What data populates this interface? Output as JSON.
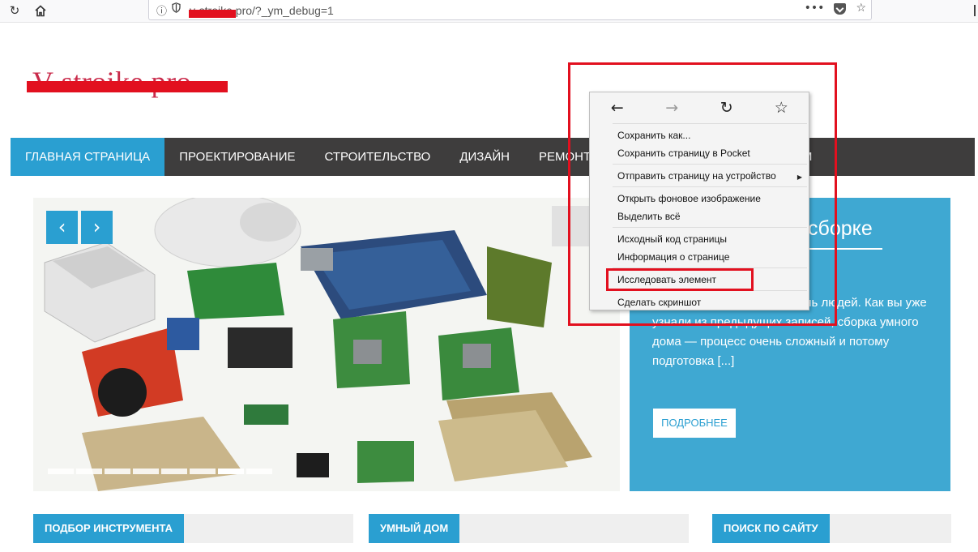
{
  "browser": {
    "url_text": "v-stroike.pro/?_ym_debug=1",
    "icons": {
      "reload": "reload-icon",
      "home": "home-icon",
      "info": "info-icon",
      "shield": "shield-icon",
      "more": "more-icon",
      "pocket": "pocket-icon",
      "bookmark": "bookmark-star-icon"
    }
  },
  "site": {
    "logo": "V-stroike.pro",
    "nav": [
      {
        "label": "ГЛАВНАЯ СТРАНИЦА",
        "active": true
      },
      {
        "label": "ПРОЕКТИРОВАНИЕ"
      },
      {
        "label": "СТРОИТЕЛЬСТВО"
      },
      {
        "label": "ДИЗАЙН"
      },
      {
        "label": "РЕМОНТ И ОТ"
      },
      {
        "label": "Й ДОМ"
      }
    ],
    "slider": {
      "prev": "‹",
      "next": "›",
      "dot_count": 8,
      "current_dot": 7
    },
    "panel": {
      "title": "сборке",
      "text": "...динально меняющая жизнь людей. Как вы уже узнали из предыдущих записей, сборка умного дома — процесс очень сложный и потому подготовка [...]",
      "button": "ПОДРОБНЕЕ"
    },
    "widgets": [
      "ПОДБОР ИНСТРУМЕНТА",
      "УМНЫЙ ДОМ",
      "ПОИСК ПО САЙТУ"
    ]
  },
  "context_menu": {
    "nav": {
      "back": "←",
      "forward": "→",
      "reload": "↻",
      "bookmark": "☆"
    },
    "items": [
      "Сохранить как...",
      "Сохранить страницу в Pocket",
      "Отправить страницу на устройство",
      "Открыть фоновое изображение",
      "Выделить всё",
      "Исходный код страницы",
      "Информация о странице",
      "Исследовать элемент",
      "Сделать скриншот"
    ],
    "submenu_arrow": "▶"
  },
  "colors": {
    "accent": "#2a9fd1",
    "nav_bg": "#3e3d3d",
    "panel_bg": "#3fa8d2",
    "annotation": "#e2101f"
  }
}
